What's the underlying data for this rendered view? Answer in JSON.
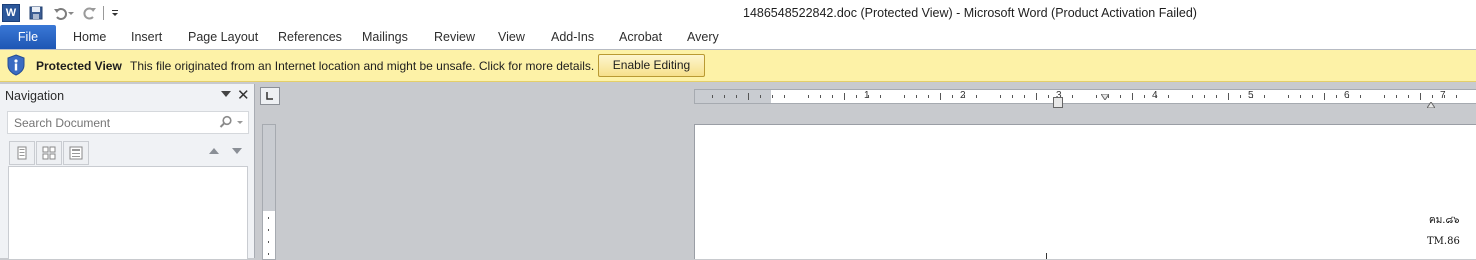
{
  "window": {
    "title": "1486548522842.doc (Protected View)  -  Microsoft Word (Product Activation Failed)"
  },
  "qat": {
    "logo_letter": "W",
    "icons": [
      "save-icon",
      "undo-icon",
      "redo-icon",
      "customize-qat-icon"
    ]
  },
  "ribbon": {
    "tabs": [
      "File",
      "Home",
      "Insert",
      "Page Layout",
      "References",
      "Mailings",
      "Review",
      "View",
      "Add-Ins",
      "Acrobat",
      "Avery"
    ]
  },
  "protected_view": {
    "title": "Protected View",
    "message": "This file originated from an Internet location and might be unsafe. Click for more details.",
    "button": "Enable Editing"
  },
  "navigation": {
    "title": "Navigation",
    "close": "✕",
    "search_placeholder": "Search Document"
  },
  "ruler": {
    "numbers": [
      "1",
      "2",
      "3",
      "4",
      "5",
      "6",
      "7"
    ]
  },
  "document": {
    "line1": "ฅม.๘๖",
    "line2": "TM.86"
  },
  "colors": {
    "file_tab": "#2b63c2",
    "protected_bar": "#fdf2a7",
    "workspace": "#c8cace"
  }
}
